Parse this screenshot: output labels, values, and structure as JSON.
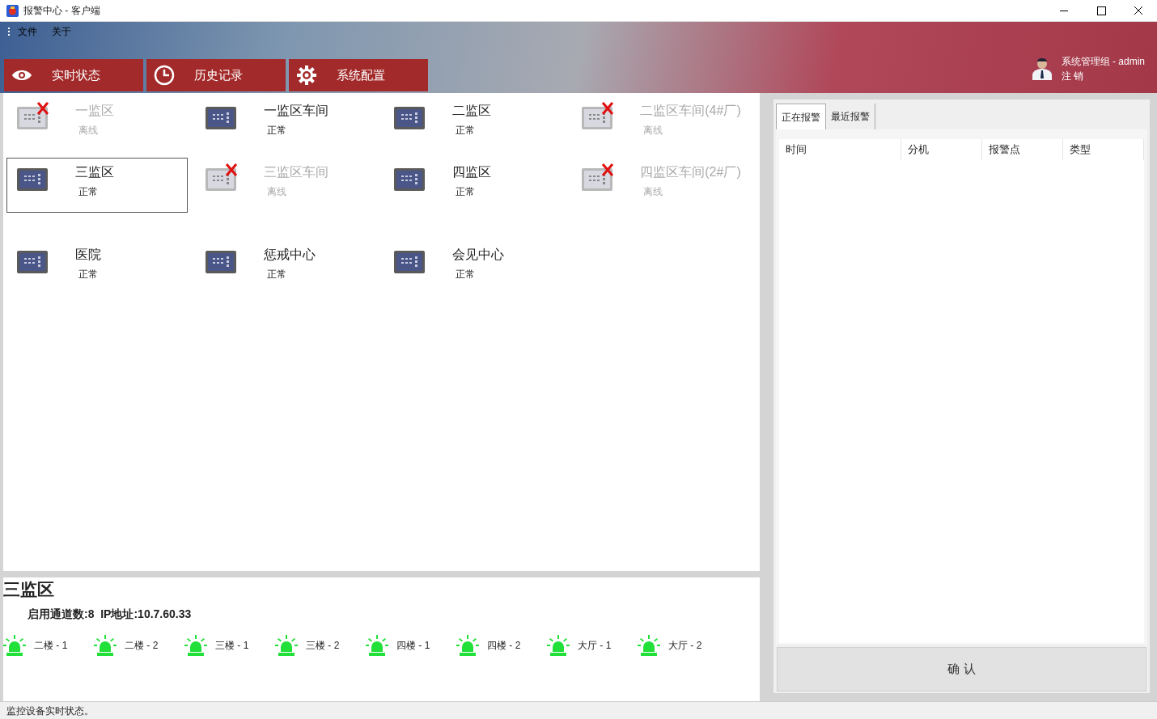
{
  "window": {
    "title": "报警中心 - 客户端"
  },
  "menu": [
    "文件",
    "关于"
  ],
  "nav": [
    {
      "label": "实时状态",
      "kind": "eye"
    },
    {
      "label": "历史记录",
      "kind": "clock"
    },
    {
      "label": "系统配置",
      "kind": "gear"
    }
  ],
  "user": {
    "name": "系统管理组 - admin",
    "logout": "注 销"
  },
  "devices": [
    {
      "name": "一监区",
      "status": "离线",
      "online": false,
      "selected": false
    },
    {
      "name": "一监区车间",
      "status": "正常",
      "online": true,
      "selected": false
    },
    {
      "name": "二监区",
      "status": "正常",
      "online": true,
      "selected": false
    },
    {
      "name": "二监区车间(4#厂)",
      "status": "离线",
      "online": false,
      "selected": false
    },
    {
      "name": "三监区",
      "status": "正常",
      "online": true,
      "selected": true
    },
    {
      "name": "三监区车间",
      "status": "离线",
      "online": false,
      "selected": false
    },
    {
      "name": "四监区",
      "status": "正常",
      "online": true,
      "selected": false
    },
    {
      "name": "四监区车间(2#厂)",
      "status": "离线",
      "online": false,
      "selected": false
    },
    {
      "name": "医院",
      "status": "正常",
      "online": true,
      "selected": false
    },
    {
      "name": "惩戒中心",
      "status": "正常",
      "online": true,
      "selected": false
    },
    {
      "name": "会见中心",
      "status": "正常",
      "online": true,
      "selected": false
    }
  ],
  "detail": {
    "title": "三监区",
    "info": "启用通道数:8  IP地址:10.7.60.33",
    "channels": [
      "二楼 - 1",
      "二楼 - 2",
      "三楼 - 1",
      "三楼 - 2",
      "四楼 - 1",
      "四楼 - 2",
      "大厅 - 1",
      "大厅 - 2"
    ]
  },
  "alarm_tabs": [
    {
      "label": "正在报警",
      "selected": true
    },
    {
      "label": "最近报警",
      "selected": false
    }
  ],
  "alarm_table": {
    "columns": [
      "时间",
      "分机",
      "报警点",
      "类型"
    ]
  },
  "confirm_button": "确 认",
  "status_bar": "监控设备实时状态。"
}
